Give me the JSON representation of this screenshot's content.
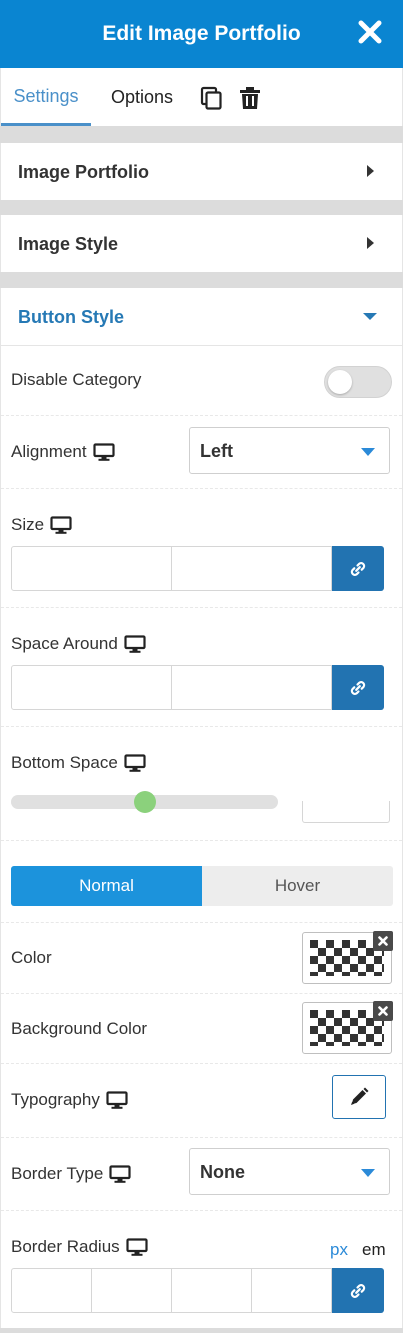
{
  "header": {
    "title": "Edit Image Portfolio",
    "close_icon": "close-icon"
  },
  "tabs": [
    {
      "label": "Settings",
      "active": true
    },
    {
      "label": "Options",
      "active": false
    }
  ],
  "tab_actions": {
    "copy_icon": "copy-icon",
    "delete_icon": "trash-icon"
  },
  "sections": [
    {
      "title": "Image Portfolio",
      "expanded": false
    },
    {
      "title": "Image Style",
      "expanded": false
    },
    {
      "title": "Button Style",
      "expanded": true
    }
  ],
  "button_style": {
    "disable_category": {
      "label": "Disable Category",
      "value": false
    },
    "alignment": {
      "label": "Alignment",
      "value": "Left"
    },
    "size": {
      "label": "Size",
      "width": "",
      "height": ""
    },
    "space_around": {
      "label": "Space Around",
      "vertical": "",
      "horizontal": ""
    },
    "bottom_space": {
      "label": "Bottom Space",
      "value": "",
      "slider_fraction": 0.5
    },
    "state_tabs": {
      "normal": "Normal",
      "hover": "Hover",
      "active": "Normal"
    },
    "color": {
      "label": "Color",
      "value": "transparent"
    },
    "background_color": {
      "label": "Background Color",
      "value": "transparent"
    },
    "typography": {
      "label": "Typography",
      "icon": "pencil-icon"
    },
    "border_type": {
      "label": "Border Type",
      "value": "None"
    },
    "border_radius": {
      "label": "Border Radius",
      "units": [
        "px",
        "em"
      ],
      "active_unit": "px",
      "values": [
        "",
        "",
        "",
        ""
      ]
    }
  },
  "colors": {
    "header": "#0a85d1",
    "accent": "#2273b1",
    "active_tab": "#1c93dc",
    "slider_knob": "#8bd17c"
  }
}
